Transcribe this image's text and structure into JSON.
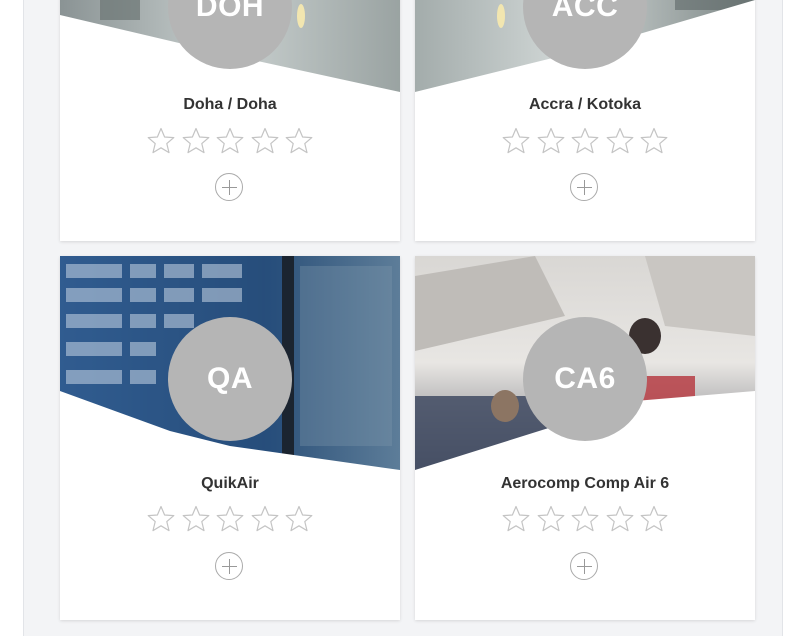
{
  "cards": [
    {
      "code": "DOH",
      "name": "Doha / Doha",
      "rating_out_of_5": 0
    },
    {
      "code": "ACC",
      "name": "Accra / Kotoka",
      "rating_out_of_5": 0
    },
    {
      "code": "QA",
      "name": "QuikAir",
      "rating_out_of_5": 0
    },
    {
      "code": "CA6",
      "name": "Aerocomp Comp Air 6",
      "rating_out_of_5": 0
    }
  ],
  "icons": {
    "star": "star-outline-icon",
    "add": "plus-circle-icon"
  },
  "colors": {
    "badge": "#b5b5b5",
    "star_outline": "#c8c8c8",
    "panel": "#f3f4f6"
  }
}
